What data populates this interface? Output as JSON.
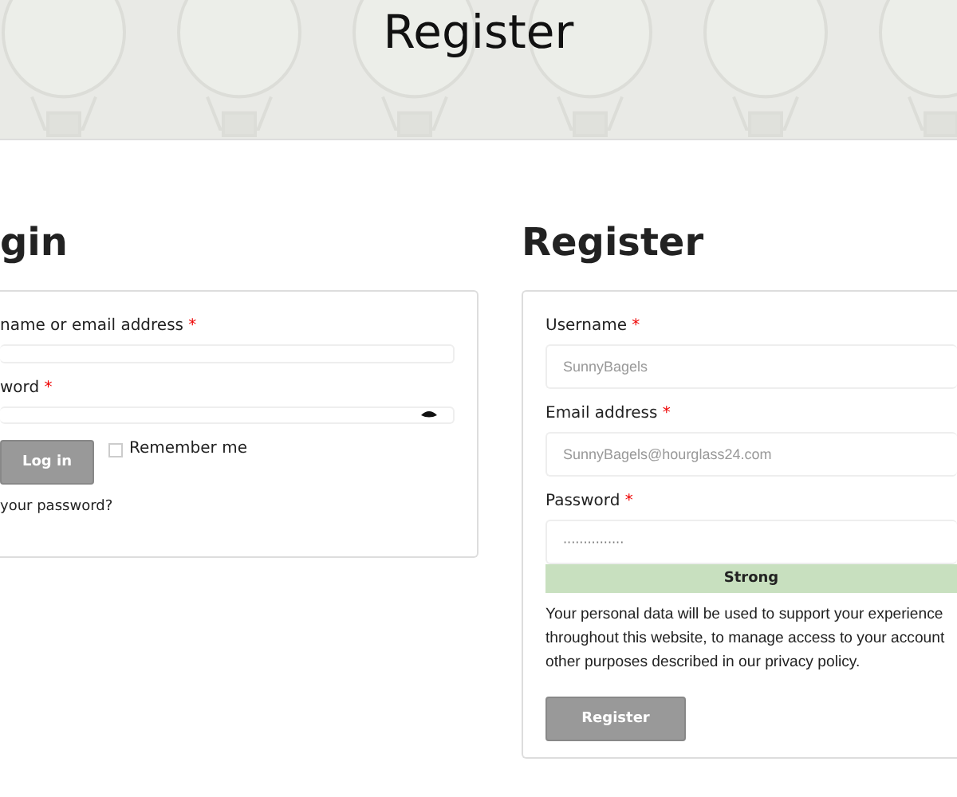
{
  "banner": {
    "title": "Register"
  },
  "login": {
    "heading": "gin",
    "fields": [
      {
        "label": "name or email address",
        "required_mark": "*",
        "kind": "text"
      },
      {
        "label": "word",
        "required_mark": "*",
        "kind": "password"
      }
    ],
    "button": "Log in",
    "remember": {
      "label": "Remember me",
      "checked": false
    },
    "lost_link": "your password?"
  },
  "register": {
    "heading": "Register",
    "fields": [
      {
        "label": "Username",
        "required_mark": "*",
        "placeholder": "SunnyBagels"
      },
      {
        "label": "Email address",
        "required_mark": "*",
        "placeholder": "SunnyBagels@hourglass24.com"
      },
      {
        "label": "Password",
        "required_mark": "*",
        "value": "···············"
      }
    ],
    "strength": "Strong",
    "privacy_lines": [
      "Your personal data will be used to support your experience",
      "throughout this website, to manage access to your account",
      "other purposes described in our privacy policy."
    ],
    "button": "Register"
  }
}
